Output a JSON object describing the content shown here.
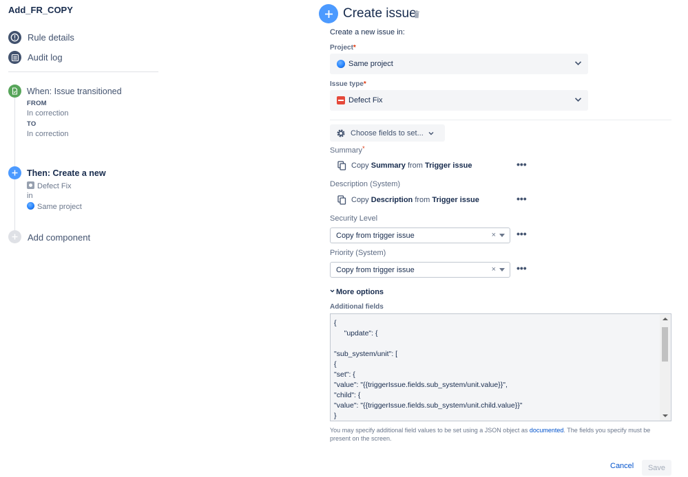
{
  "rule": {
    "name": "Add_FR_COPY"
  },
  "sidebar": {
    "links": [
      {
        "label": "Rule details",
        "icon": "info-icon"
      },
      {
        "label": "Audit log",
        "icon": "list-icon"
      }
    ],
    "trigger": {
      "title": "When: Issue transitioned",
      "from_label": "FROM",
      "from_value": "In correction",
      "to_label": "TO",
      "to_value": "In correction"
    },
    "action": {
      "title": "Then: Create a new",
      "issue_type": "Defect Fix",
      "in_label": "in",
      "project": "Same project"
    },
    "add_component": "Add component"
  },
  "main": {
    "title": "Create issue",
    "subtitle": "Create a new issue in:",
    "project": {
      "label": "Project",
      "required": "*",
      "value": "Same project"
    },
    "issue_type": {
      "label": "Issue type",
      "required": "*",
      "value": "Defect Fix"
    },
    "choose_fields": "Choose fields to set...",
    "summary": {
      "label": "Summary",
      "required": "*",
      "copy": "Copy",
      "field": "Summary",
      "from": "from",
      "source": "Trigger issue"
    },
    "description": {
      "label": "Description (System)",
      "copy": "Copy",
      "field": "Description",
      "from": "from",
      "source": "Trigger issue"
    },
    "security_level": {
      "label": "Security Level",
      "value": "Copy from trigger issue"
    },
    "priority": {
      "label": "Priority (System)",
      "value": "Copy from trigger issue"
    },
    "more_options": "More options",
    "additional_fields": {
      "label": "Additional fields",
      "json": "{\n     \"update\": {\n\n\"sub_system/unit\": [\n{\n\"set\": {\n\"value\": \"{{triggerIssue.fields.sub_system/unit.value}}\",\n\"child\": {\n\"value\": \"{{triggerIssue.fields.sub_system/unit.child.value}}\"\n}"
    },
    "help": {
      "before": "You may specify additional field values to be set using a JSON object as ",
      "link": "documented",
      "after": ". The fields you specify must be present on the screen."
    },
    "cancel": "Cancel",
    "save": "Save",
    "dots": "•••",
    "clear": "×"
  },
  "colors": {
    "accent": "#4c9aff",
    "link": "#0052cc",
    "trigger_green": "#57a55a",
    "required": "#de350b"
  }
}
